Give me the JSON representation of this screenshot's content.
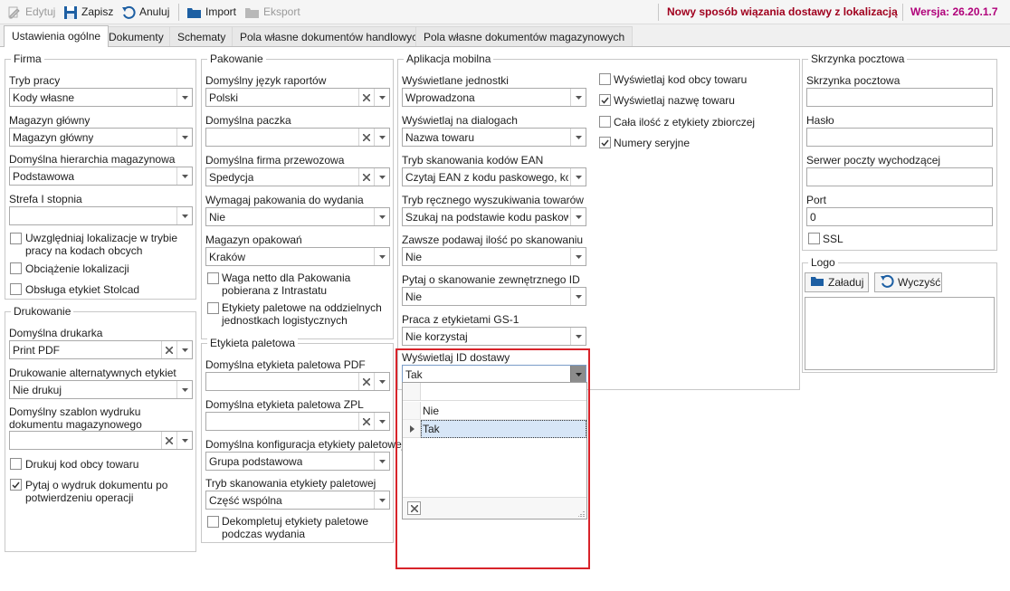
{
  "toolbar": {
    "edit": "Edytuj",
    "save": "Zapisz",
    "cancel": "Anuluj",
    "import": "Import",
    "export": "Eksport"
  },
  "notice": "Nowy sposób wiązania dostawy z lokalizacją",
  "version": "Wersja: 26.20.1.7",
  "tabs": [
    "Ustawienia ogólne",
    "Dokumenty",
    "Schematy",
    "Pola własne dokumentów handlowych",
    "Pola własne dokumentów magazynowych"
  ],
  "firma": {
    "title": "Firma",
    "tryb_label": "Tryb pracy",
    "tryb_value": "Kody własne",
    "magazyn_label": "Magazyn główny",
    "magazyn_value": "Magazyn główny",
    "hierarchia_label": "Domyślna hierarchia magazynowa",
    "hierarchia_value": "Podstawowa",
    "strefa_label": "Strefa I stopnia",
    "strefa_value": "",
    "cb1": "Uwzględniaj lokalizacje w trybie pracy na kodach obcych",
    "cb2": "Obciążenie lokalizacji",
    "cb3": "Obsługa etykiet Stolcad"
  },
  "drukowanie": {
    "title": "Drukowanie",
    "drukarka_label": "Domyślna drukarka",
    "drukarka_value": "Print PDF",
    "alt_label": "Drukowanie alternatywnych etykiet",
    "alt_value": "Nie drukuj",
    "szablon_label": "Domyślny szablon wydruku dokumentu magazynowego",
    "szablon_value": "",
    "cb1": "Drukuj kod obcy towaru",
    "cb2": "Pytaj o wydruk dokumentu po potwierdzeniu operacji"
  },
  "pakowanie": {
    "title": "Pakowanie",
    "jezyk_label": "Domyślny język raportów",
    "jezyk_value": "Polski",
    "paczka_label": "Domyślna paczka",
    "paczka_value": "",
    "firma_label": "Domyślna firma przewozowa",
    "firma_value": "Spedycja",
    "wymagaj_label": "Wymagaj pakowania do wydania",
    "wymagaj_value": "Nie",
    "opak_label": "Magazyn opakowań",
    "opak_value": "Kraków",
    "cb1": "Waga netto dla Pakowania pobierana z Intrastatu",
    "cb2": "Etykiety paletowe na oddzielnych jednostkach logistycznych"
  },
  "etykieta": {
    "title": "Etykieta paletowa",
    "pdf_label": "Domyślna etykieta paletowa PDF",
    "pdf_value": "",
    "zpl_label": "Domyślna etykieta paletowa ZPL",
    "zpl_value": "",
    "konf_label": "Domyślna konfiguracja etykiety paletowej",
    "konf_value": "Grupa podstawowa",
    "tryb_label": "Tryb skanowania etykiety paletowej",
    "tryb_value": "Część wspólna",
    "cb1": "Dekompletuj etykiety paletowe podczas wydania"
  },
  "aplikacja": {
    "title": "Aplikacja mobilna",
    "jedn_label": "Wyświetlane jednostki",
    "jedn_value": "Wprowadzona",
    "dial_label": "Wyświetlaj na dialogach",
    "dial_value": "Nazwa towaru",
    "ean_label": "Tryb skanowania kodów EAN",
    "ean_value": "Czytaj EAN z kodu paskowego, kod...",
    "reczny_label": "Tryb ręcznego wyszukiwania towarów",
    "reczny_value": "Szukaj na podstawie kodu paskowe...",
    "ilosc_label": "Zawsze podawaj ilość po skanowaniu",
    "ilosc_value": "Nie",
    "zewn_label": "Pytaj o skanowanie zewnętrznego ID",
    "zewn_value": "Nie",
    "gs1_label": "Praca z etykietami GS-1",
    "gs1_value": "Nie korzystaj",
    "id_label": "Wyświetlaj ID dostawy",
    "id_value": "Tak",
    "options": [
      "Nie",
      "Tak"
    ],
    "cb1": "Wyświetlaj kod obcy towaru",
    "cb2": "Wyświetlaj nazwę towaru",
    "cb3": "Cała ilość z etykiety zbiorczej",
    "cb4": "Numery seryjne"
  },
  "skrzynka": {
    "title": "Skrzynka pocztowa",
    "skrzynka_label": "Skrzynka pocztowa",
    "skrzynka_value": "",
    "haslo_label": "Hasło",
    "haslo_value": "",
    "serwer_label": "Serwer poczty wychodzącej",
    "serwer_value": "",
    "port_label": "Port",
    "port_value": "0",
    "ssl": "SSL"
  },
  "logo": {
    "title": "Logo",
    "load": "Załaduj",
    "clear": "Wyczyść"
  },
  "colors": {
    "notice": "#a0001e",
    "version": "#b0007a",
    "highlight": "#d8232a"
  }
}
